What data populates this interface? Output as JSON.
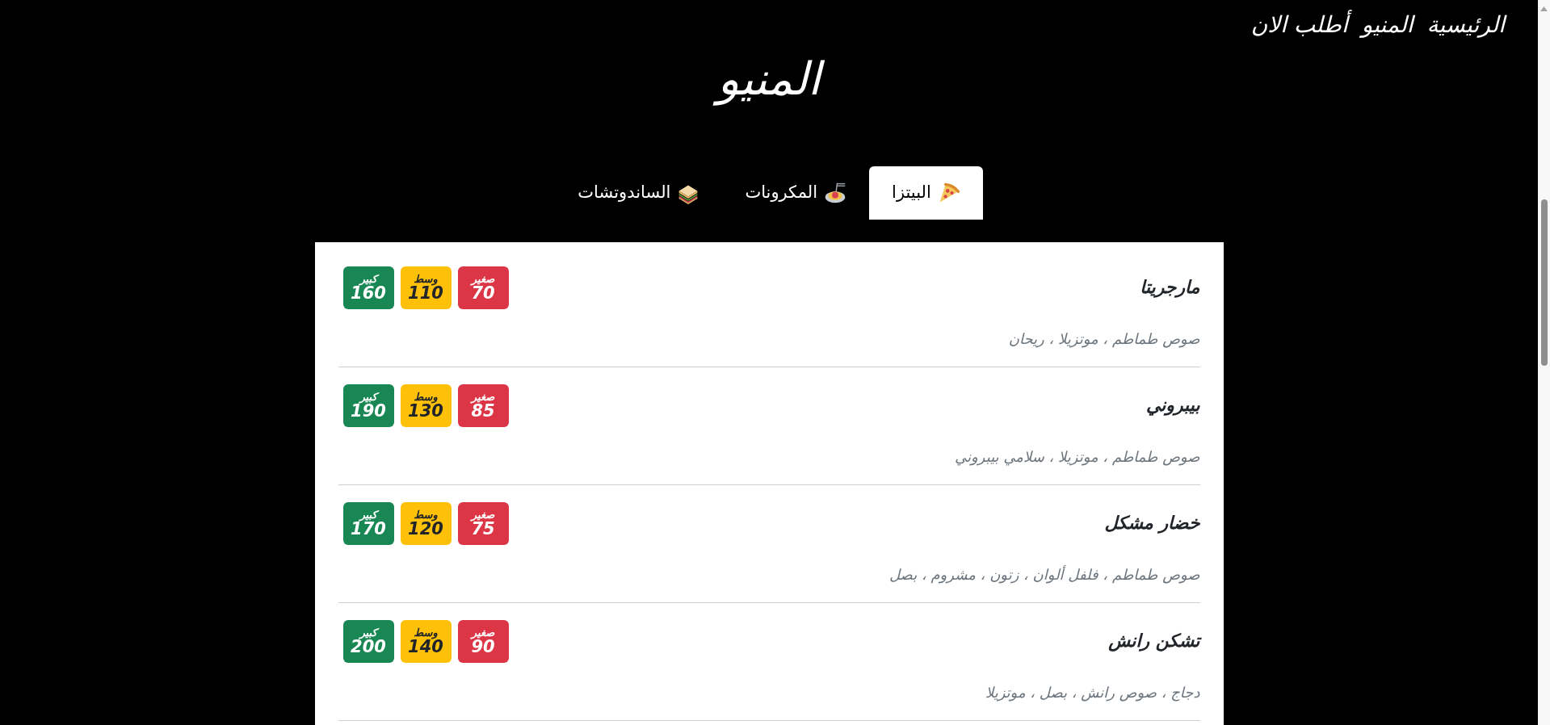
{
  "nav": {
    "links": [
      "الرئيسية",
      "المنيو",
      "أطلب الان"
    ]
  },
  "page_title": "المنيو",
  "tabs": [
    {
      "label": "البيتزا",
      "selected": true
    },
    {
      "label": "المكرونات",
      "selected": false
    },
    {
      "label": "الساندوتشات",
      "selected": false
    }
  ],
  "menu_items": [
    {
      "name": "مارجريتا",
      "description": "صوص طماطم ، موتزيلا ، ريحان",
      "prices": [
        {
          "size": "صغير",
          "price": "70",
          "color": "#dc3545"
        },
        {
          "size": "وسط",
          "price": "110",
          "color": "#ffc107"
        },
        {
          "size": "كبير",
          "price": "160",
          "color": "#198754"
        }
      ]
    },
    {
      "name": "بيبروني",
      "description": "صوص طماطم ، موتزيلا ، سلامي بيبروني",
      "prices": [
        {
          "size": "صغير",
          "price": "85",
          "color": "#dc3545"
        },
        {
          "size": "وسط",
          "price": "130",
          "color": "#ffc107"
        },
        {
          "size": "كبير",
          "price": "190",
          "color": "#198754"
        }
      ]
    },
    {
      "name": "خضار مشكل",
      "description": "صوص طماطم ، فلفل ألوان ، زتون ، مشروم ، بصل",
      "prices": [
        {
          "size": "صغير",
          "price": "75",
          "color": "#dc3545"
        },
        {
          "size": "وسط",
          "price": "120",
          "color": "#ffc107"
        },
        {
          "size": "كبير",
          "price": "170",
          "color": "#198754"
        }
      ]
    },
    {
      "name": "تشكن رانش",
      "description": "دجاج ، صوص رانش ، بصل ، موتزيلا",
      "prices": [
        {
          "size": "صغير",
          "price": "90",
          "color": "#dc3545"
        },
        {
          "size": "وسط",
          "price": "140",
          "color": "#ffc107"
        },
        {
          "size": "كبير",
          "price": "200",
          "color": "#198754"
        }
      ]
    }
  ]
}
